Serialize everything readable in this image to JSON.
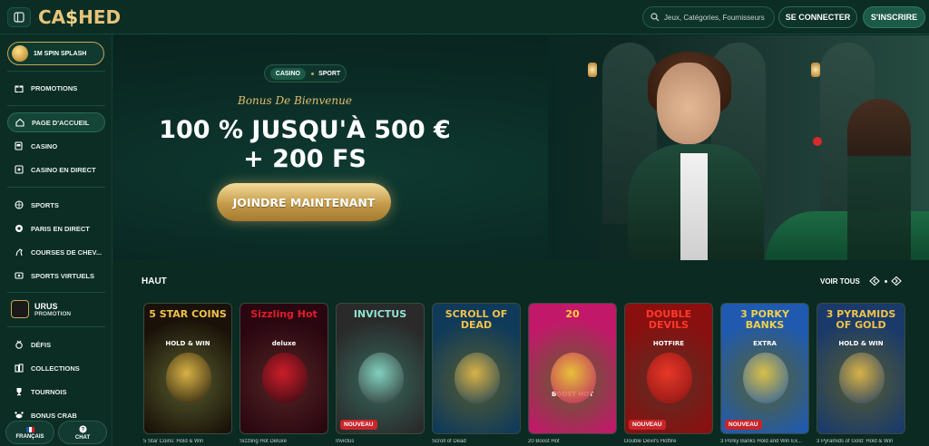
{
  "header": {
    "logo_text_left": "CA",
    "logo_dollar": "$",
    "logo_text_right": "HED",
    "search_placeholder": "Jeux, Catégories, Fournisseurs",
    "login_label": "SE CONNECTER",
    "signup_label": "S'INSCRIRE"
  },
  "sidebar": {
    "spin_label": "1M SPIN SPLASH",
    "items": [
      {
        "label": "PROMOTIONS",
        "icon": "gift-icon"
      },
      {
        "label": "PAGE D'ACCUEIL",
        "icon": "home-icon"
      },
      {
        "label": "CASINO",
        "icon": "slot-icon"
      },
      {
        "label": "CASINO EN DIRECT",
        "icon": "live-icon"
      },
      {
        "label": "SPORTS",
        "icon": "ball-icon"
      },
      {
        "label": "PARIS EN DIRECT",
        "icon": "live-bet-icon"
      },
      {
        "label": "COURSES DE CHEV...",
        "icon": "horse-icon"
      },
      {
        "label": "SPORTS VIRTUELS",
        "icon": "virtual-icon"
      },
      {
        "label": "DÉFIS",
        "icon": "challenge-icon"
      },
      {
        "label": "COLLECTIONS",
        "icon": "collection-icon"
      },
      {
        "label": "TOURNOIS",
        "icon": "trophy-icon"
      },
      {
        "label": "BONUS CRAB",
        "icon": "crab-icon"
      }
    ],
    "urus_title": "URUS",
    "urus_sub": "PROMOTION",
    "lang_label": "FRANÇAIS",
    "chat_label": "CHAT"
  },
  "hero": {
    "tab_casino": "CASINO",
    "tab_sport": "SPORT",
    "bonus_text": "Bonus De Bienvenue",
    "headline_1": "100 % JUSQU'À 500 €",
    "headline_2": "+ 200 FS",
    "cta_label": "JOINDRE MAINTENANT"
  },
  "games": {
    "section_title": "HAUT",
    "see_all": "VOIR TOUS",
    "cards": [
      {
        "art_title": "5 STAR COINS",
        "art_sub": "HOLD & WIN",
        "name": "5 Star Coins: Hold & Win",
        "tag": "",
        "bg": "#1a1208",
        "accent": "#f0c24a"
      },
      {
        "art_title": "Sizzling Hot",
        "art_sub": "deluxe",
        "name": "Sizzling Hot Deluxe",
        "tag": "",
        "bg": "#2a0610",
        "accent": "#e11d2a"
      },
      {
        "art_title": "INVICTUS",
        "art_sub": "",
        "name": "Invictus",
        "tag": "NOUVEAU",
        "bg": "#2a2a2a",
        "accent": "#8fe3d0"
      },
      {
        "art_title": "SCROLL OF DEAD",
        "art_sub": "",
        "name": "Scroll of Dead",
        "tag": "",
        "bg": "#0f3a5a",
        "accent": "#f0c24a"
      },
      {
        "art_title": "20",
        "art_sub": "BOOST HOT",
        "name": "20 Boost Hot",
        "tag": "",
        "bg": "#c2186a",
        "accent": "#ffd23a"
      },
      {
        "art_title": "DOUBLE DEVILS",
        "art_sub": "HOTFIRE",
        "name": "Double Devil's Hotfire",
        "tag": "NOUVEAU",
        "bg": "#8a0f0f",
        "accent": "#ff3a2a"
      },
      {
        "art_title": "3 PORKY BANKS",
        "art_sub": "EXTRA",
        "name": "3 Porky Banks Hold and Win Ex...",
        "tag": "NOUVEAU",
        "bg": "#1f5ab0",
        "accent": "#f0d04a"
      },
      {
        "art_title": "3 PYRAMIDS OF GOLD",
        "art_sub": "HOLD & WIN",
        "name": "3 Pyramids of Gold: Hold & Win",
        "tag": "",
        "bg": "#1a3a6a",
        "accent": "#f0c24a"
      }
    ]
  }
}
